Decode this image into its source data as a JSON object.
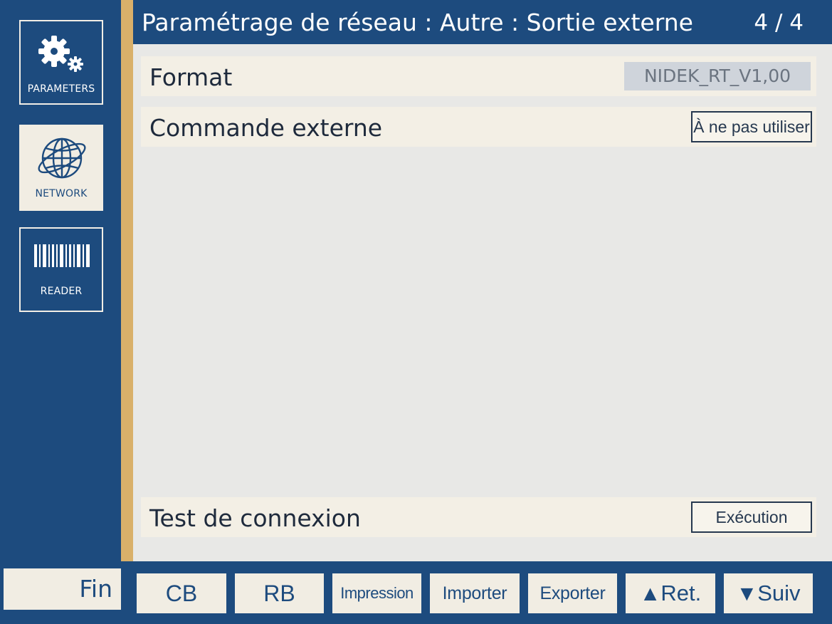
{
  "sidebar": {
    "items": [
      {
        "label": "PARAMETERS",
        "icon": "gears-icon",
        "active": false
      },
      {
        "label": "NETWORK",
        "icon": "globe-icon",
        "active": true
      },
      {
        "label": "READER",
        "icon": "barcode-icon",
        "active": false
      }
    ]
  },
  "header": {
    "title": "Paramétrage de réseau : Autre : Sortie externe",
    "page_indicator": "4 / 4"
  },
  "settings": {
    "format": {
      "label": "Format",
      "value": "NIDEK_RT_V1,00"
    },
    "external_command": {
      "label": "Commande externe",
      "value": "À ne pas utiliser"
    },
    "connection_test": {
      "label": "Test de connexion",
      "button": "Exécution"
    }
  },
  "footer": {
    "fin": "Fin",
    "cb": "CB",
    "rb": "RB",
    "print": "Impression",
    "import": "Importer",
    "export": "Exporter",
    "prev_arrow": "▲",
    "prev": "Ret.",
    "next_arrow": "▼",
    "next": "Suiv"
  },
  "colors": {
    "navy": "#1d4b7e",
    "gold": "#d9b06a",
    "panel": "#e8e8e6",
    "row": "#f3efe5"
  }
}
